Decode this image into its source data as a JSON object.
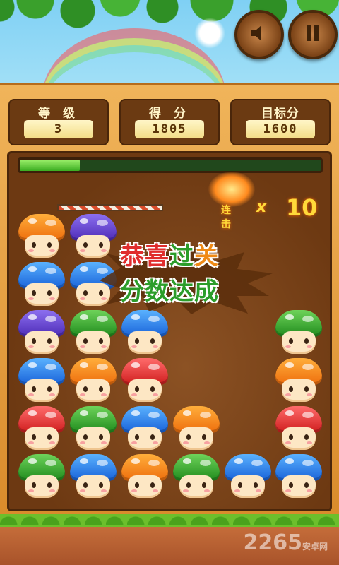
{
  "controls": {
    "sound_icon": "speaker-icon",
    "pause_icon": "pause-icon"
  },
  "stats": [
    {
      "label": "等 级",
      "value": "3"
    },
    {
      "label": "得 分",
      "value": "1805"
    },
    {
      "label": "目标分",
      "value": "1600"
    }
  ],
  "progress": {
    "fraction": 0.2
  },
  "combo": {
    "label": "连击",
    "x": "x",
    "count": "10"
  },
  "message": {
    "line1": [
      "恭",
      "喜",
      "过",
      "关"
    ],
    "line2": [
      "分",
      "数",
      "达",
      "成"
    ]
  },
  "grid": {
    "rows": [
      [
        "orange",
        "purple",
        null,
        null,
        null,
        null
      ],
      [
        "blue",
        "blue",
        null,
        null,
        null,
        null
      ],
      [
        "purple",
        "green",
        "blue",
        null,
        null,
        "green"
      ],
      [
        "blue",
        "orange",
        "red",
        null,
        null,
        "orange"
      ],
      [
        "red",
        "green",
        "blue",
        "orange",
        null,
        "red"
      ],
      [
        "green",
        "blue",
        "orange",
        "green",
        "blue",
        "blue"
      ]
    ]
  },
  "watermark": {
    "main": "2265",
    "sub": "安卓网"
  },
  "colors": {
    "frame": "#e9a046",
    "board": "#7a4317",
    "progress": "#5ed13b"
  }
}
